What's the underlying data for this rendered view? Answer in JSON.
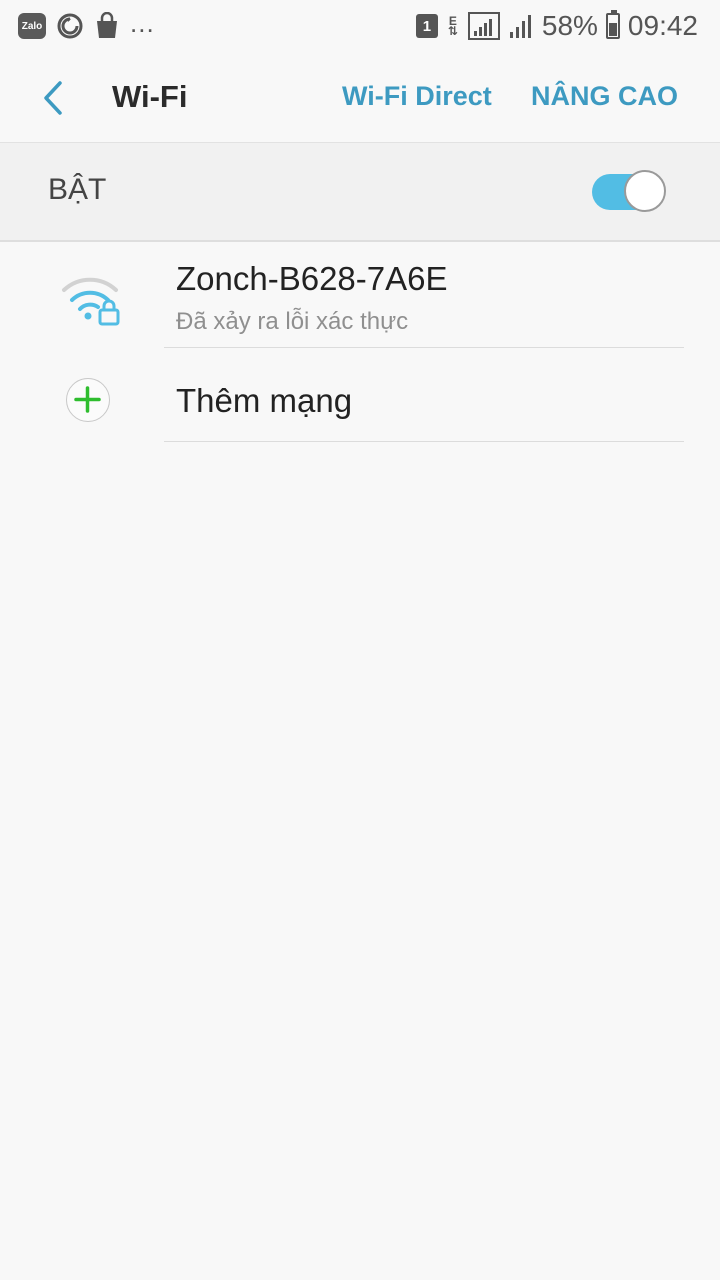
{
  "status_bar": {
    "left_icons": [
      "zalo-icon",
      "sync-icon",
      "shopping-bag-icon"
    ],
    "zalo_label": "Zalo",
    "more": "...",
    "sim_slot": "1",
    "network_type": "E",
    "battery_percent": "58%",
    "battery_level": 0.58,
    "time": "09:42"
  },
  "header": {
    "title": "Wi-Fi",
    "wifi_direct": "Wi-Fi Direct",
    "advanced": "NÂNG CAO"
  },
  "master_switch": {
    "label": "BẬT",
    "on": true
  },
  "networks": [
    {
      "name": "Zonch-B628-7A6E",
      "status": "Đã xảy ra lỗi xác thực",
      "icon": "wifi-lock-icon"
    }
  ],
  "add_network": {
    "label": "Thêm mạng",
    "icon": "add-icon"
  },
  "colors": {
    "accent": "#3d9ac1",
    "toggle_on": "#52bde4",
    "add_green": "#2ebd2e",
    "background": "#f8f8f8"
  }
}
